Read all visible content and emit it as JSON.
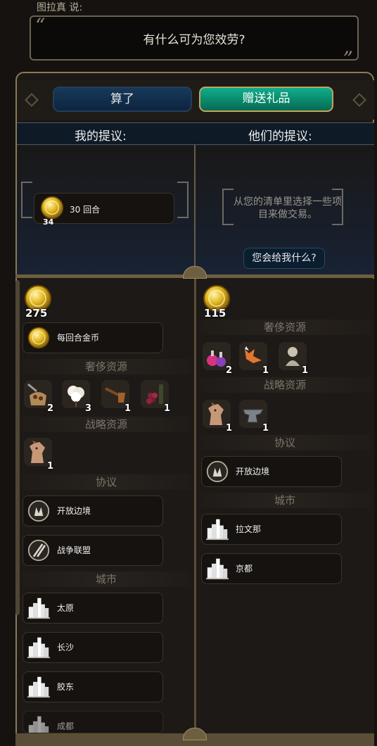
{
  "speech": {
    "speaker": "图拉真 说:",
    "text": "有什么可为您效劳?"
  },
  "buttons": {
    "cancel": "算了",
    "gift": "赠送礼品"
  },
  "offer": {
    "my_title": "我的提议:",
    "their_title": "他们的提议:",
    "my_item": {
      "label": "30 回合",
      "count": "34",
      "icon": "gold-coin-icon"
    },
    "empty_hint": "从您的清单里选择一些项目来做交易。",
    "ask_button": "您会给我什么?"
  },
  "left_list": {
    "gold": "275",
    "per_turn_gold": "每回合金币",
    "luxury_header": "奢侈资源",
    "luxury": [
      {
        "icon": "coffee-icon",
        "count": "2"
      },
      {
        "icon": "cotton-icon",
        "count": "3"
      },
      {
        "icon": "tobacco-pipe-icon",
        "count": "1"
      },
      {
        "icon": "wine-icon",
        "count": "1"
      }
    ],
    "strategic_header": "战略资源",
    "strategic": [
      {
        "icon": "horse-icon",
        "count": "1"
      }
    ],
    "agreement_header": "协议",
    "agreements": [
      "开放边境",
      "战争联盟"
    ],
    "city_header": "城市",
    "cities": [
      "太原",
      "长沙",
      "胶东",
      "成都"
    ]
  },
  "right_list": {
    "gold": "115",
    "luxury_header": "奢侈资源",
    "luxury": [
      {
        "icon": "perfume-icon",
        "count": "2"
      },
      {
        "icon": "fur-icon",
        "count": "1"
      },
      {
        "icon": "statue-icon",
        "count": "1"
      }
    ],
    "strategic_header": "战略资源",
    "strategic": [
      {
        "icon": "horse-icon",
        "count": "1"
      },
      {
        "icon": "iron-icon",
        "count": "1"
      }
    ],
    "agreement_header": "协议",
    "agreements": [
      "开放边境"
    ],
    "city_header": "城市",
    "cities": [
      "拉文那",
      "京都"
    ]
  },
  "colors": {
    "gift_button": "#0fae8c",
    "cancel_button": "#17395a",
    "frame": "#8b7b55"
  }
}
